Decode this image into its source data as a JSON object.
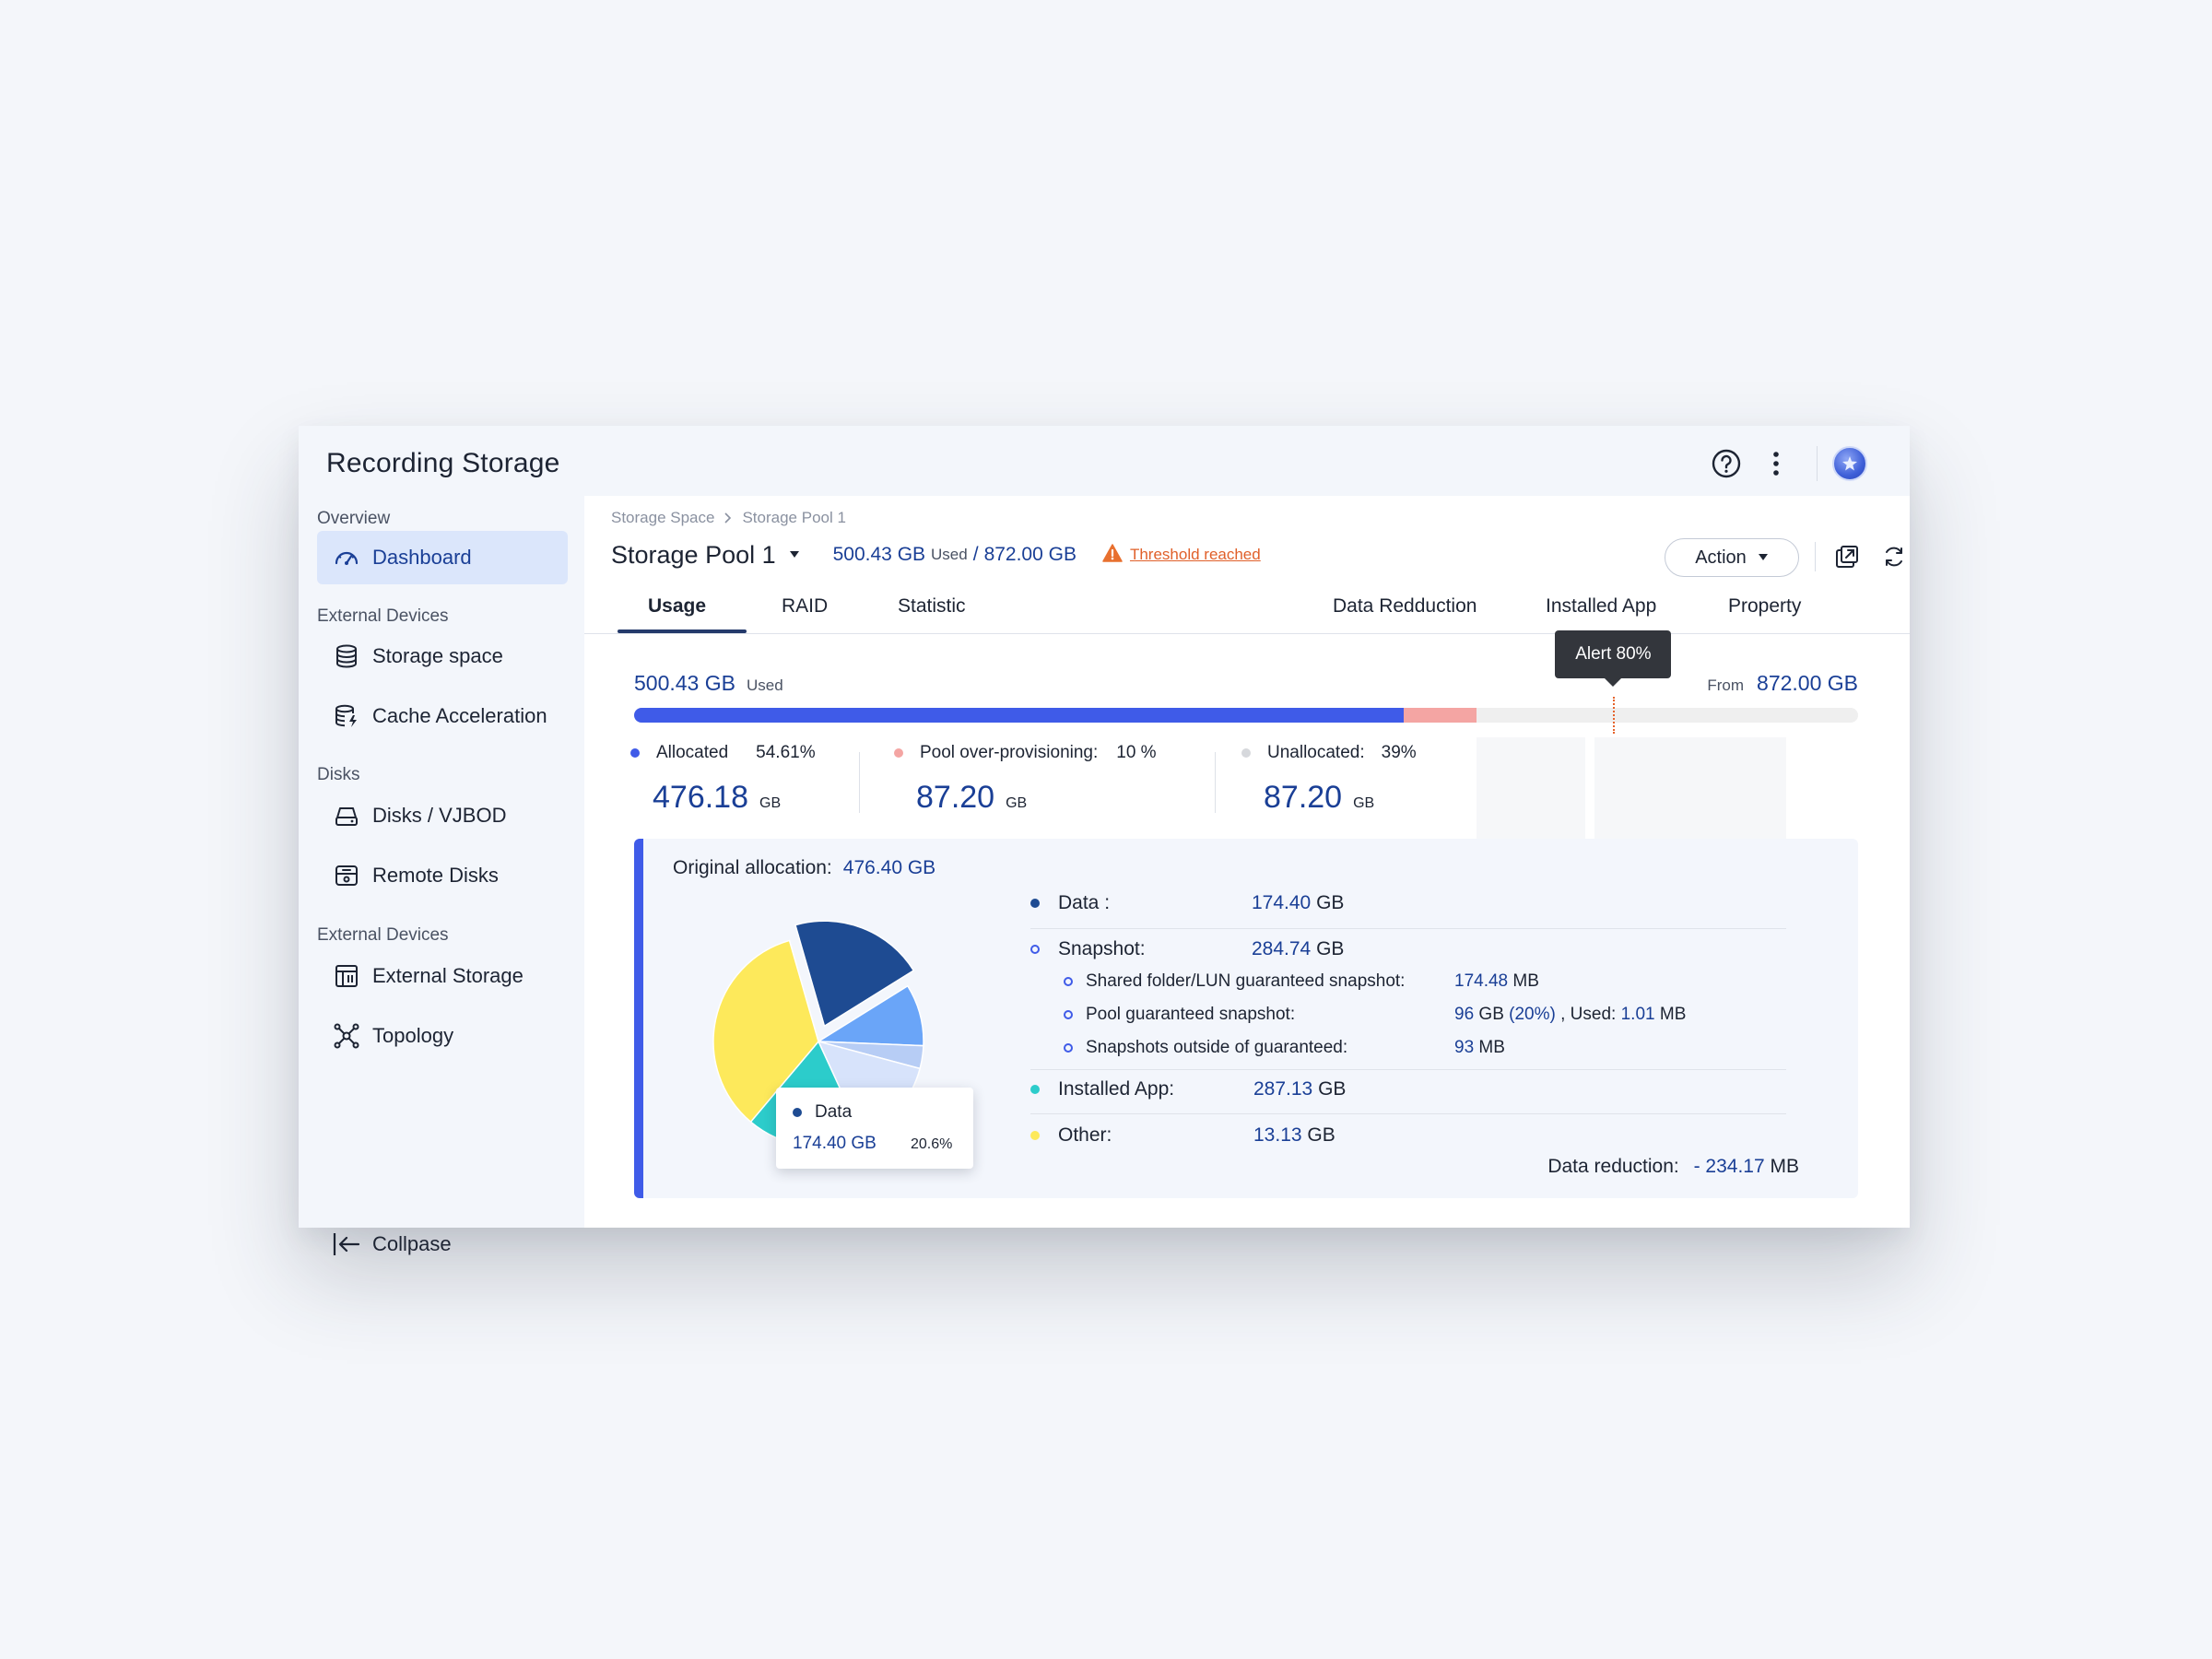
{
  "app": {
    "title": "Recording Storage"
  },
  "sidebar": {
    "groups": [
      "Overview",
      "External Devices",
      "Disks",
      "External Devices"
    ],
    "items": [
      {
        "label": "Dashboard",
        "icon": "gauge-icon"
      },
      {
        "label": "Storage space",
        "icon": "database-icon"
      },
      {
        "label": "Cache Acceleration",
        "icon": "cache-icon"
      },
      {
        "label": "Disks / VJBOD",
        "icon": "disk-icon"
      },
      {
        "label": "Remote Disks",
        "icon": "remote-disk-icon"
      },
      {
        "label": "External Storage",
        "icon": "external-storage-icon"
      },
      {
        "label": "Topology",
        "icon": "topology-icon"
      }
    ],
    "collapse_label": "Collpase"
  },
  "breadcrumb": [
    "Storage Space",
    "Storage Pool 1"
  ],
  "pool": {
    "name": "Storage Pool 1",
    "used": "500.43 GB",
    "used_label": "Used",
    "separator": "/",
    "total": "872.00 GB",
    "threshold_text": "Threshold reached",
    "action_label": "Action"
  },
  "tabs": [
    "Usage",
    "RAID",
    "Statistic",
    "Data Redduction",
    "Installed App",
    "Property"
  ],
  "usage": {
    "used_value": "500.43 GB",
    "used_label": "Used",
    "from_label": "From",
    "from_value": "872.00 GB",
    "alert_label": "Alert 80%",
    "alert_fraction": 0.8,
    "allocated_fraction": 0.6284,
    "overprov_fraction": 0.0595,
    "stats": [
      {
        "label": "Allocated",
        "pct": "54.61%",
        "value": "476.18",
        "unit": "GB",
        "color": "#3f5be8"
      },
      {
        "label": "Pool over-provisioning:",
        "pct": "10 %",
        "value": "87.20",
        "unit": "GB",
        "color": "#f4a5a3"
      },
      {
        "label": "Unallocated:",
        "pct": "39%",
        "value": "87.20",
        "unit": "GB",
        "color": "#d6d8dc"
      }
    ]
  },
  "detail": {
    "orig_label": "Original allocation:",
    "orig_value": "476.40 GB",
    "data_label": "Data :",
    "data_value": "174.40",
    "data_unit": "GB",
    "snapshot_label": "Snapshot:",
    "snapshot_value": "284.74",
    "snapshot_unit": "GB",
    "shared_label": "Shared folder/LUN guaranteed snapshot:",
    "shared_value": "174.48",
    "shared_unit": "MB",
    "pool_snap_label": "Pool guaranteed snapshot:",
    "pool_snap_value": "96",
    "pool_snap_unit": "GB",
    "pool_snap_pct": "(20%)",
    "pool_snap_used_label": ", Used:",
    "pool_snap_used_value": "1.01",
    "pool_snap_used_unit": "MB",
    "outside_label": "Snapshots outside of guaranteed:",
    "outside_value": "93",
    "outside_unit": "MB",
    "app_label": "Installed App:",
    "app_value": "287.13",
    "app_unit": "GB",
    "other_label": "Other:",
    "other_value": "13.13",
    "other_unit": "GB",
    "reduction_label": "Data reduction:",
    "reduction_value": "- 234.17",
    "reduction_unit": "MB",
    "tooltip": {
      "label": "Data",
      "value": "174.40 GB",
      "pct": "20.6%"
    }
  },
  "chart_data": {
    "type": "pie",
    "slices": [
      {
        "label": "Data",
        "value": 20.6,
        "color": "#1e4b92",
        "exploded": true
      },
      {
        "label": "Snapshot",
        "value": 9.5,
        "color": "#6aa5f8"
      },
      {
        "label": "Snapshot",
        "value": 3.5,
        "color": "#b7cdf5"
      },
      {
        "label": "Snapshot",
        "value": 14,
        "color": "#d7e3fb"
      },
      {
        "label": "Installed App",
        "value": 18,
        "color": "#2ccccb"
      },
      {
        "label": "Other",
        "value": 34.4,
        "color": "#fde95b"
      }
    ]
  },
  "colors": {
    "accent": "#3f5be8",
    "navy": "#1a3f96",
    "warn": "#e0602a"
  }
}
